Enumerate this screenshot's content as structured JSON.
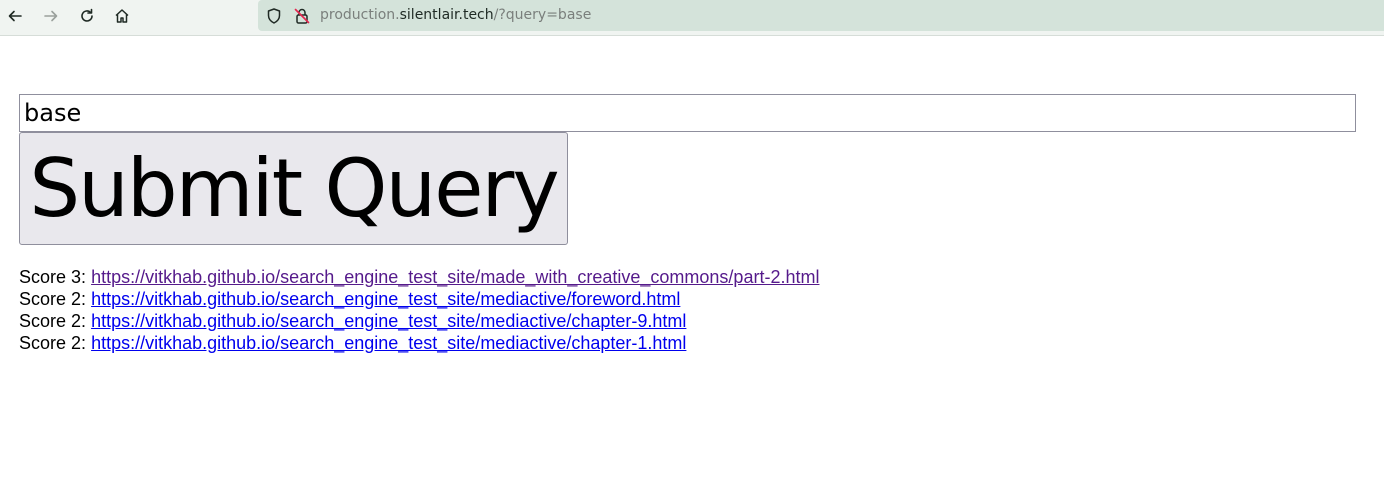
{
  "browser": {
    "url_host_prefix": "production.",
    "url_host_main": "silentlair.tech",
    "url_path": "/?query=base"
  },
  "search": {
    "value": "base",
    "submit_label": "Submit Query"
  },
  "results": [
    {
      "score_label": "Score 3:",
      "url": "https://vitkhab.github.io/search_engine_test_site/made_with_creative_commons/part-2.html",
      "visited": true
    },
    {
      "score_label": "Score 2:",
      "url": "https://vitkhab.github.io/search_engine_test_site/mediactive/foreword.html",
      "visited": false
    },
    {
      "score_label": "Score 2:",
      "url": "https://vitkhab.github.io/search_engine_test_site/mediactive/chapter-9.html",
      "visited": false
    },
    {
      "score_label": "Score 2:",
      "url": "https://vitkhab.github.io/search_engine_test_site/mediactive/chapter-1.html",
      "visited": false
    }
  ],
  "colors": {
    "link": "#0000ee",
    "visited_link": "#551a8b",
    "urlbar_bg": "#d4e3da",
    "button_bg": "#e9e8ed"
  }
}
